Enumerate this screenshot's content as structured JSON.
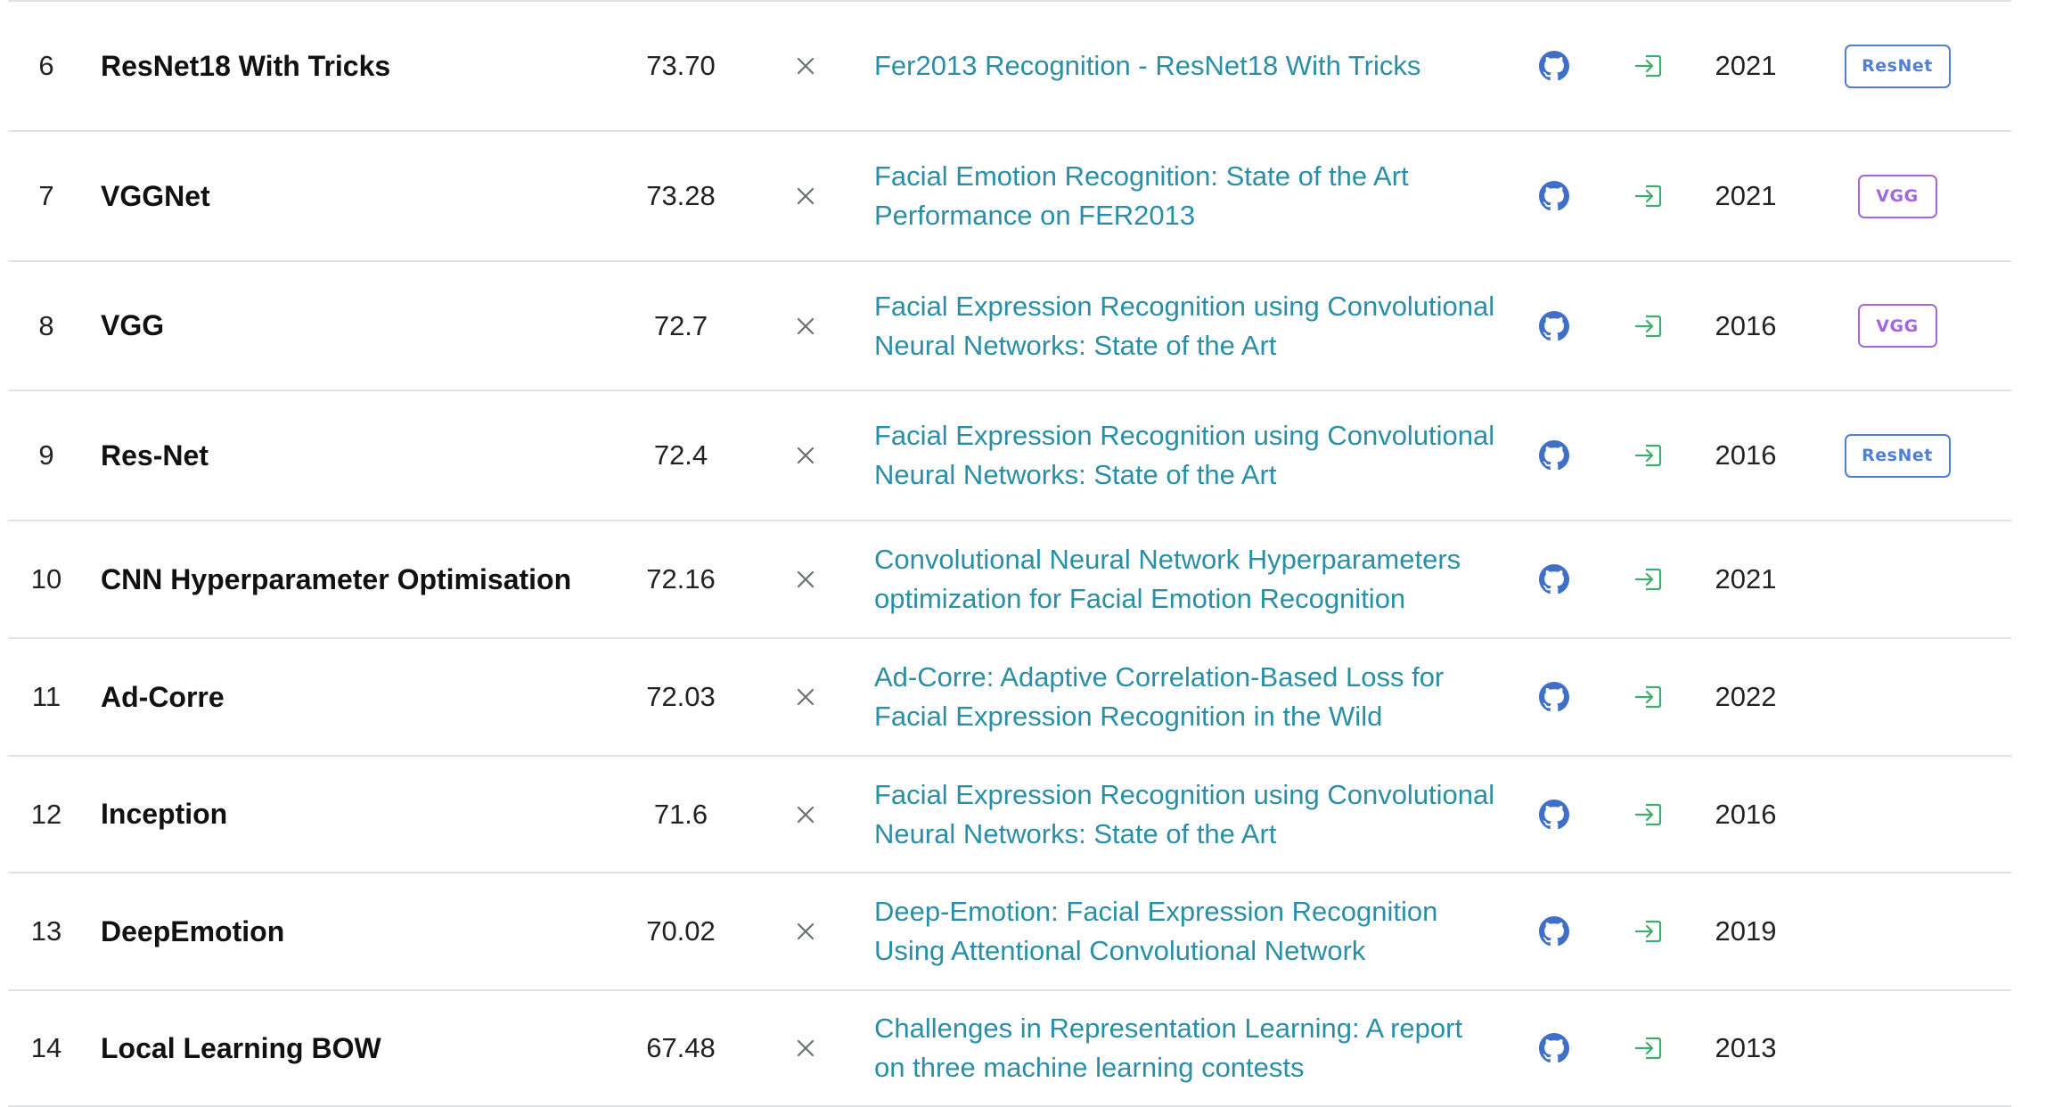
{
  "leaderboard": {
    "rows": [
      {
        "rank": "6",
        "model": "ResNet18 With Tricks",
        "score": "73.70",
        "paper": "Fer2013 Recognition - ResNet18 With Tricks",
        "year": "2021",
        "tag": "ResNet",
        "tag_color": "#4f7fd6"
      },
      {
        "rank": "7",
        "model": "VGGNet",
        "score": "73.28",
        "paper": "Facial Emotion Recognition: State of the Art Performance on FER2013",
        "year": "2021",
        "tag": "VGG",
        "tag_color": "#a565e0"
      },
      {
        "rank": "8",
        "model": "VGG",
        "score": "72.7",
        "paper": "Facial Expression Recognition using Convolutional Neural Networks: State of the Art",
        "year": "2016",
        "tag": "VGG",
        "tag_color": "#a565e0"
      },
      {
        "rank": "9",
        "model": "Res-Net",
        "score": "72.4",
        "paper": "Facial Expression Recognition using Convolutional Neural Networks: State of the Art",
        "year": "2016",
        "tag": "ResNet",
        "tag_color": "#4f7fd6"
      },
      {
        "rank": "10",
        "model": "CNN Hyperparameter Optimisation",
        "score": "72.16",
        "paper": "Convolutional Neural Network Hyperparameters optimization for Facial Emotion Recognition",
        "year": "2021",
        "tag": null,
        "tag_color": null
      },
      {
        "rank": "11",
        "model": "Ad-Corre",
        "score": "72.03",
        "paper": "Ad-Corre: Adaptive Correlation-Based Loss for Facial Expression Recognition in the Wild",
        "year": "2022",
        "tag": null,
        "tag_color": null
      },
      {
        "rank": "12",
        "model": "Inception",
        "score": "71.6",
        "paper": "Facial Expression Recognition using Convolutional Neural Networks: State of the Art",
        "year": "2016",
        "tag": null,
        "tag_color": null
      },
      {
        "rank": "13",
        "model": "DeepEmotion",
        "score": "70.02",
        "paper": "Deep-Emotion: Facial Expression Recognition Using Attentional Convolutional Network",
        "year": "2019",
        "tag": null,
        "tag_color": null
      },
      {
        "rank": "14",
        "model": "Local Learning BOW",
        "score": "67.48",
        "paper": "Challenges in Representation Learning: A report on three machine learning contests",
        "year": "2013",
        "tag": null,
        "tag_color": null
      }
    ]
  },
  "icons": {
    "extra_training_data": "close-icon",
    "code": "github-icon",
    "result": "sign-in-arrow-icon"
  },
  "colors": {
    "link": "#2a8fa6",
    "github": "#3f6fc8",
    "result_icon": "#3dad6f",
    "x_mark": "#6b6f73",
    "divider": "#dfe3e8"
  }
}
